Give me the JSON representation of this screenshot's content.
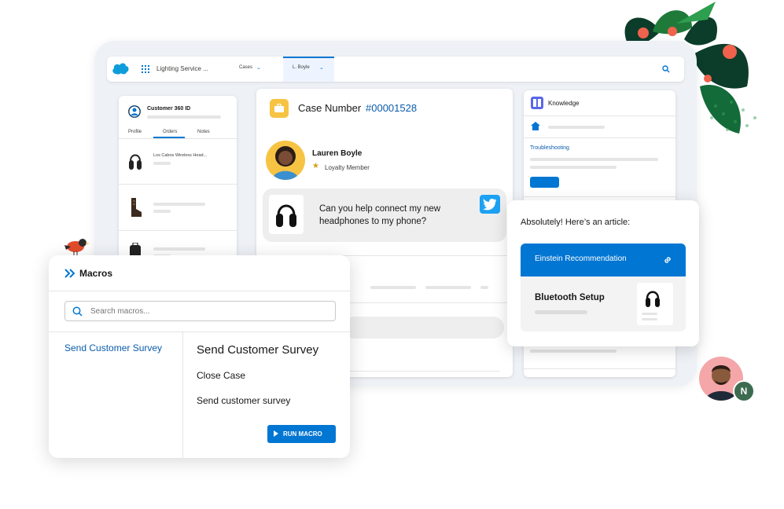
{
  "topbar": {
    "app_name": "Lighting Service ...",
    "tab_cases": "Cases",
    "tab_record": "L. Boyle"
  },
  "customer360": {
    "title": "Customer 360 ID",
    "tabs": [
      "Profile",
      "Orders",
      "Notes"
    ],
    "product_name": "Los Cabos Wireless Head..."
  },
  "case": {
    "label": "Case Number",
    "number": "#00001528",
    "customer_name": "Lauren Boyle",
    "customer_tier": "Loyalty Member",
    "message": "Can you help connect my new headphones to my phone?"
  },
  "knowledge": {
    "title": "Knowledge",
    "link": "Troubleshooting"
  },
  "article_popup": {
    "intro": "Absolutely! Here’s an article:",
    "recommendation_label": "Einstein Recommendation",
    "article_title": "Bluetooth Setup"
  },
  "macros": {
    "title": "Macros",
    "search_placeholder": "Search macros...",
    "selected_item": "Send Customer Survey",
    "detail_title": "Send Customer Survey",
    "steps": [
      "Close Case",
      "Send customer survey"
    ],
    "run_button": "RUN MACRO"
  },
  "colors": {
    "brand_blue": "#0176d3",
    "link_blue": "#0b5cab",
    "twitter_blue": "#1da1f2",
    "case_icon_yellow": "#f6c343"
  },
  "avatar_badge": "N"
}
